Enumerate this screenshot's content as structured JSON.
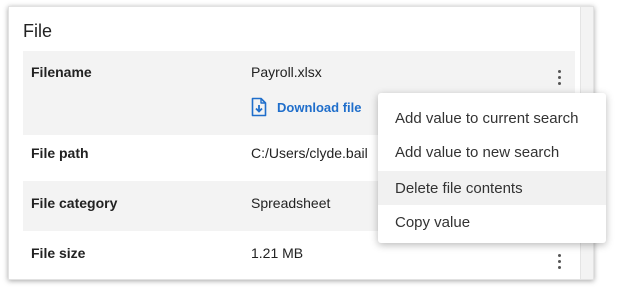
{
  "section": {
    "title": "File"
  },
  "rows": [
    {
      "label": "Filename",
      "value": "Payroll.xlsx",
      "download_label": "Download file"
    },
    {
      "label": "File path",
      "value": "C:/Users/clyde.bail"
    },
    {
      "label": "File category",
      "value": "Spreadsheet"
    },
    {
      "label": "File size",
      "value": "1.21 MB"
    }
  ],
  "context_menu": {
    "items": [
      "Add value to current search",
      "Add value to new search",
      "Delete file contents",
      "Copy value"
    ],
    "highlighted_item": "Delete file contents"
  },
  "colors": {
    "link": "#1f6ecb",
    "row_shade": "#f3f3f3",
    "menu_hover": "#f1f1f1"
  },
  "icons": [
    "file-download-icon",
    "more-vertical-icon"
  ]
}
